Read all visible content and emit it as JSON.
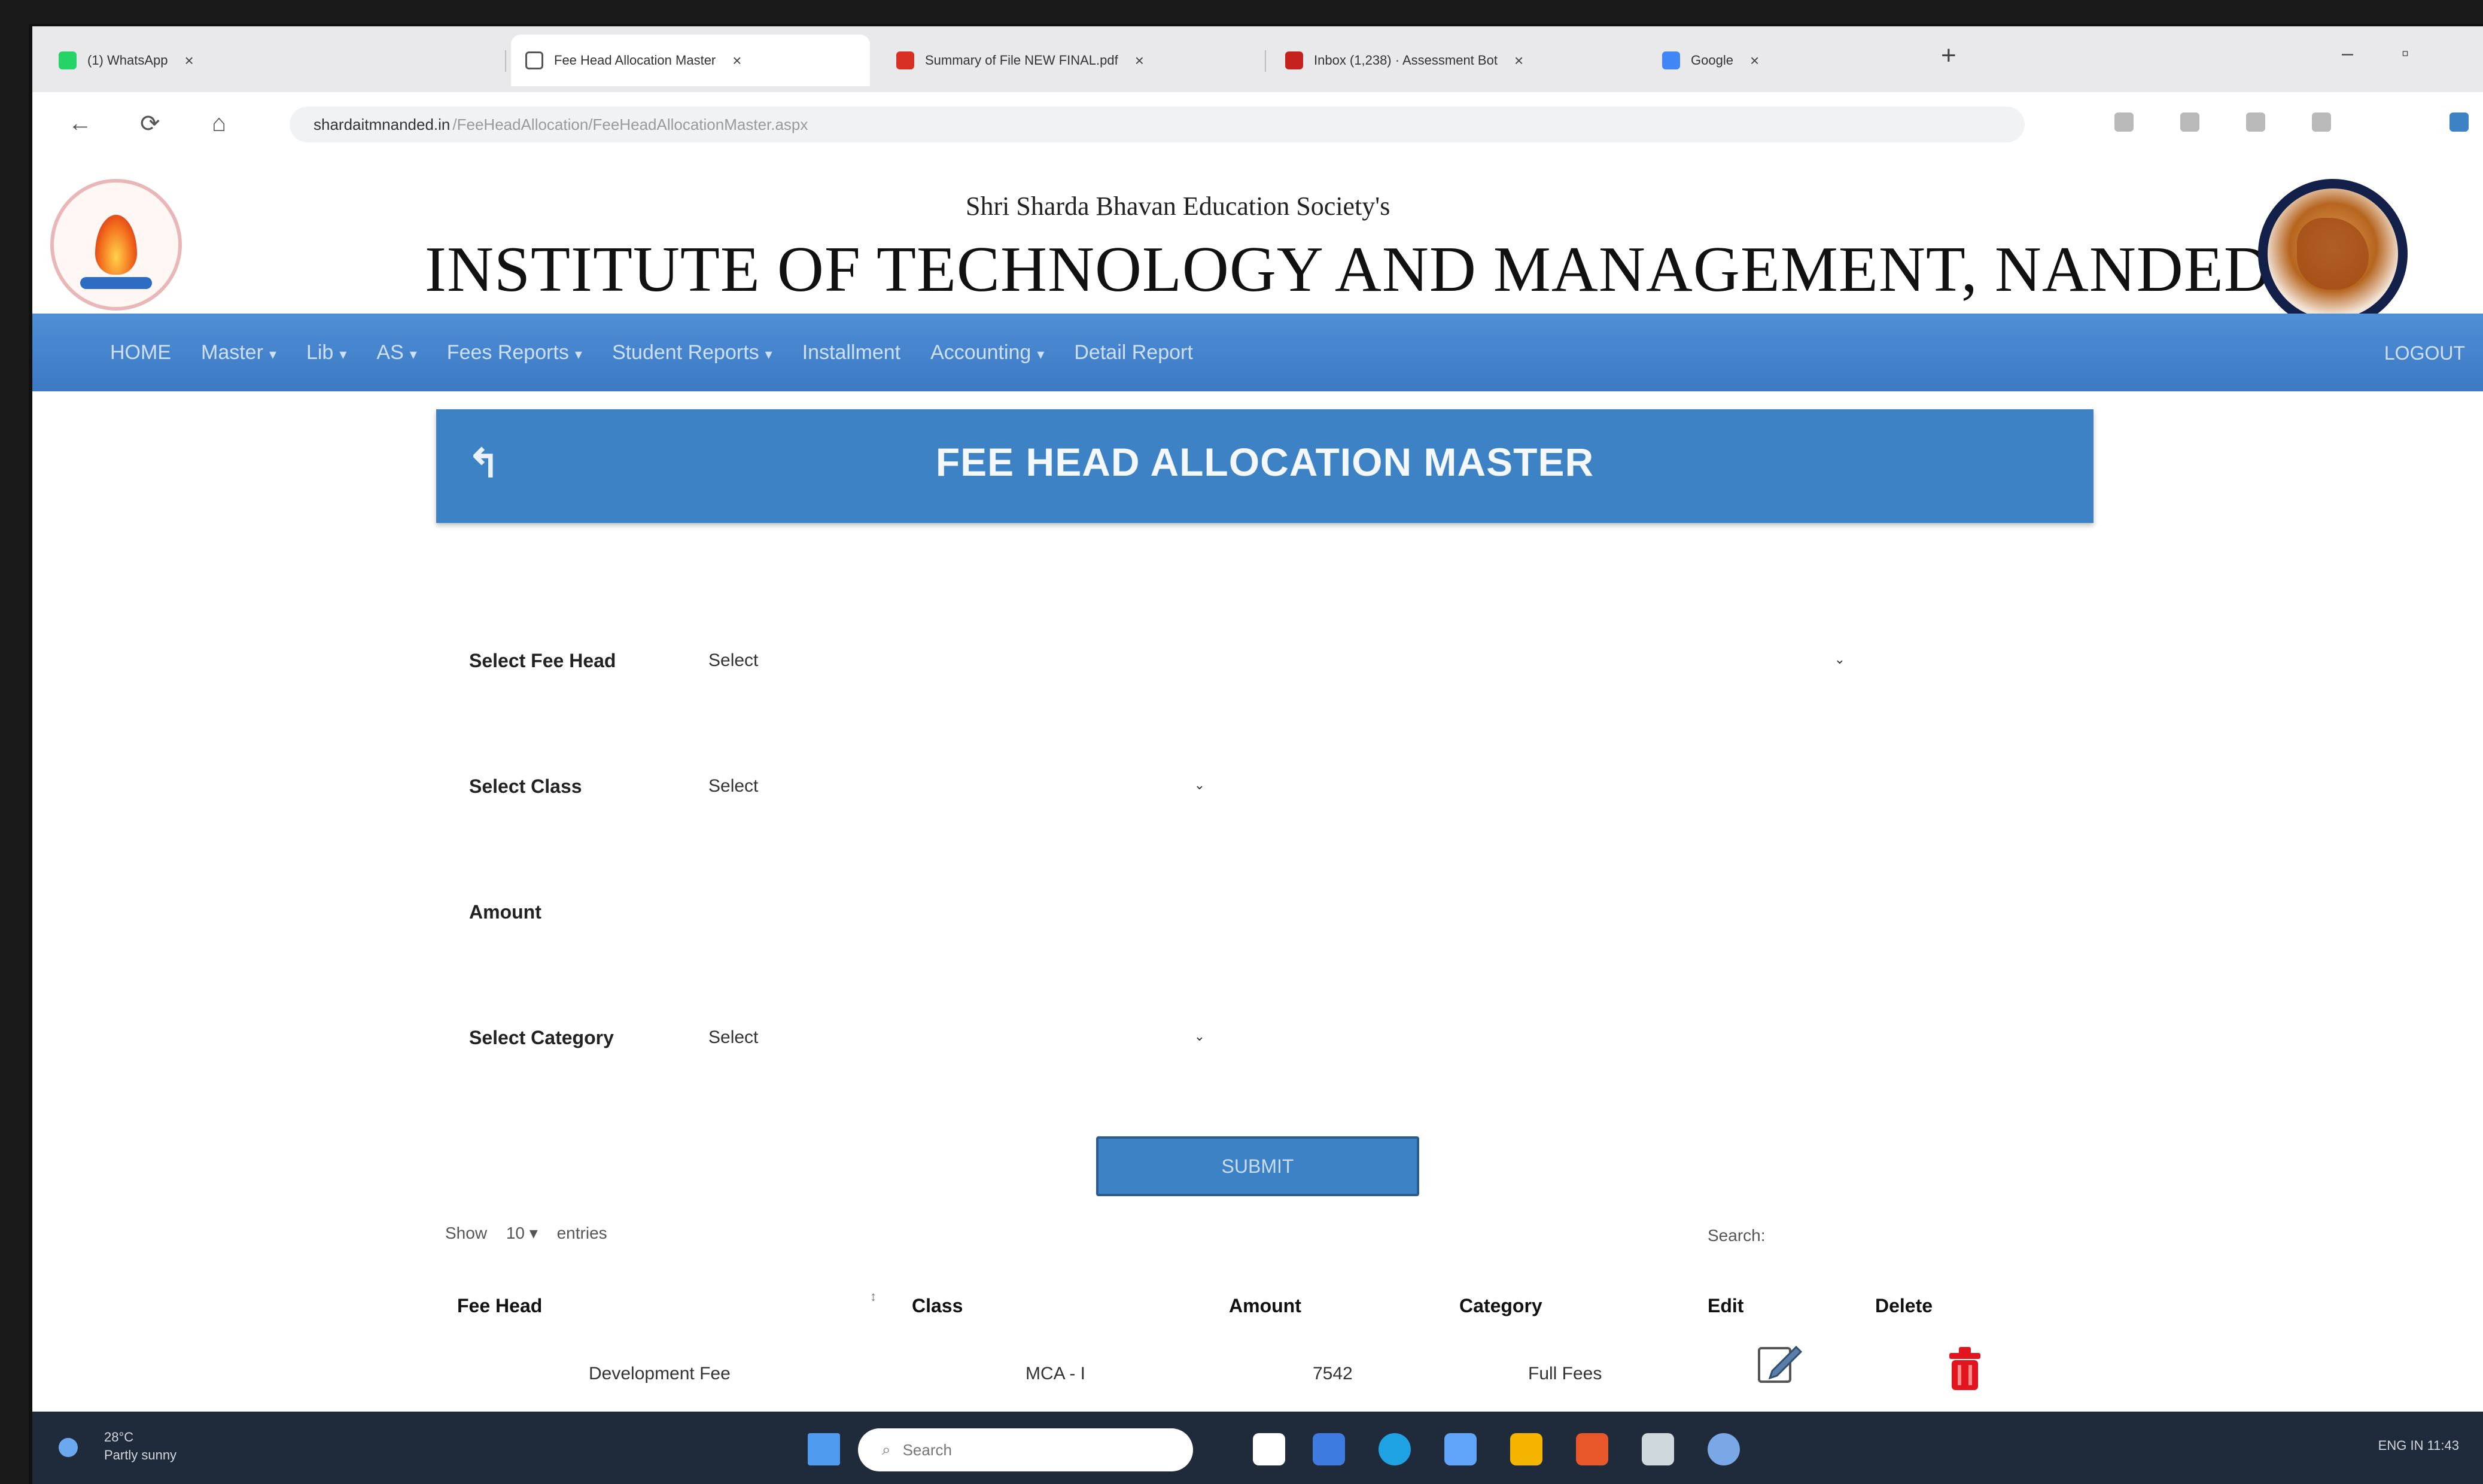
{
  "browser": {
    "tabs": [
      {
        "title": "(1) WhatsApp",
        "color": "#25d366"
      },
      {
        "title": "Fee Head Allocation Master",
        "color": "#9aa0a6",
        "active": true
      },
      {
        "title": "Summary of File NEW FINAL.pdf",
        "color": "#d93025"
      },
      {
        "title": "Inbox (1,238) · Assessment Bot",
        "color": "#c5221f"
      },
      {
        "title": "Google",
        "color": "#4285f4"
      }
    ],
    "tab_close": "×",
    "new_tab": "+",
    "url_host": "shardaitmnanded.in",
    "url_path": "/FeeHeadAllocation/FeeHeadAllocationMaster.aspx",
    "back_glyph": "←",
    "reload_glyph": "⟳",
    "home_glyph": "⌂"
  },
  "header": {
    "society": "Shri Sharda Bhavan Education Society's",
    "institute": "INSTITUTE OF TECHNOLOGY AND MANAGEMENT, NANDED"
  },
  "menu": {
    "items": [
      {
        "label": "HOME",
        "has_dropdown": false
      },
      {
        "label": "Master",
        "has_dropdown": true
      },
      {
        "label": "Lib",
        "has_dropdown": true
      },
      {
        "label": "AS",
        "has_dropdown": true
      },
      {
        "label": "Fees Reports",
        "has_dropdown": true
      },
      {
        "label": "Student Reports",
        "has_dropdown": true
      },
      {
        "label": "Installment",
        "has_dropdown": false
      },
      {
        "label": "Accounting",
        "has_dropdown": true
      },
      {
        "label": "Detail Report",
        "has_dropdown": false
      }
    ],
    "caret": "▾",
    "logout": "LOGOUT"
  },
  "banner": {
    "title": "FEE HEAD ALLOCATION MASTER",
    "back_glyph": "↰"
  },
  "form": {
    "fee_head": {
      "label": "Select Fee Head",
      "value": "Select"
    },
    "class": {
      "label": "Select Class",
      "value": "Select"
    },
    "amount": {
      "label": "Amount",
      "value": ""
    },
    "category": {
      "label": "Select Category",
      "value": "Select"
    },
    "caret": "⌄",
    "submit": "SUBMIT"
  },
  "table_controls": {
    "show_prefix": "Show",
    "page_size": "10",
    "show_suffix": "entries",
    "search_label": "Search:"
  },
  "table": {
    "columns": [
      "Fee Head",
      "Class",
      "Amount",
      "Category",
      "Edit",
      "Delete"
    ],
    "sort_glyph": "↕",
    "rows": [
      {
        "fee_head": "Development Fee",
        "class": "MCA - I",
        "amount": "7542",
        "category": "Full Fees"
      }
    ]
  },
  "taskbar": {
    "weather_line1": "28°C",
    "weather_line2": "Partly sunny",
    "search_placeholder": "Search",
    "tray": "ENG  IN   11:43",
    "colors": [
      "#ffffff",
      "#3d7be0",
      "#1fa2e3",
      "#60a5fa",
      "#f4b400",
      "#e8572a",
      "#cfd8dc",
      "#7aa7e6"
    ]
  }
}
